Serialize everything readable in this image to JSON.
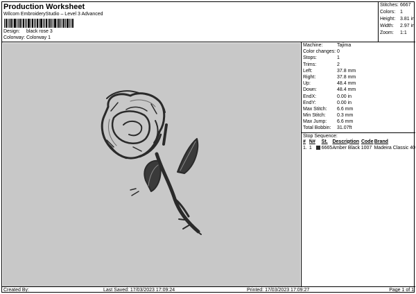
{
  "header": {
    "title": "Production Worksheet",
    "subtitle": "Wilcom EmbroideryStudio – Level 3 Advanced",
    "design_label": "Design:",
    "design_value": "black rose 3",
    "colorway_label": "Colorway:",
    "colorway_value": "Colorway 1"
  },
  "stats": [
    {
      "label": "Stitches:",
      "value": "6667"
    },
    {
      "label": "Colors:",
      "value": "1"
    },
    {
      "label": "Height:",
      "value": "3.81 in"
    },
    {
      "label": "Width:",
      "value": "2.97 in"
    },
    {
      "label": "Zoom:",
      "value": "1:1"
    }
  ],
  "info": [
    {
      "label": "Machine:",
      "value": "Tajima"
    },
    {
      "label": "Color changes:",
      "value": "0"
    },
    {
      "label": "Stops:",
      "value": "1"
    },
    {
      "label": "Trims:",
      "value": "2"
    },
    {
      "label": "Left:",
      "value": "37.8 mm"
    },
    {
      "label": "Right:",
      "value": "37.8 mm"
    },
    {
      "label": "Up:",
      "value": "48.4 mm"
    },
    {
      "label": "Down:",
      "value": "48.4 mm"
    },
    {
      "label": "EndX:",
      "value": "0.00 in"
    },
    {
      "label": "EndY:",
      "value": "0.00 in"
    },
    {
      "label": "Max Stitch:",
      "value": "6.6 mm"
    },
    {
      "label": "Min Stitch:",
      "value": "0.3 mm"
    },
    {
      "label": "Max Jump:",
      "value": "6.6 mm"
    },
    {
      "label": "Total Bobbin:",
      "value": "31.07ft"
    }
  ],
  "stop_sequence": {
    "title": "Stop Sequence:",
    "headers": {
      "num": "#",
      "n": "N#",
      "st": "St.",
      "desc": "Description",
      "code": "Code",
      "brand": "Brand"
    },
    "rows": [
      {
        "num": "1.",
        "n": "1",
        "color": "#2a2a2a",
        "st": "6665",
        "desc": "Amber Black",
        "code": "1007",
        "brand": "Madeira Classic 40"
      }
    ]
  },
  "footer": {
    "created": "Created By:",
    "saved": "Last Saved: 17/03/2023 17:09:24",
    "printed": "Printed: 17/03/2023 17:09:27",
    "page": "Page 1 of 1"
  },
  "design_icon": "rose-embroidery-image",
  "colors": {
    "canvas_bg": "#c8c8c8",
    "thread": "#2a2a2a"
  }
}
